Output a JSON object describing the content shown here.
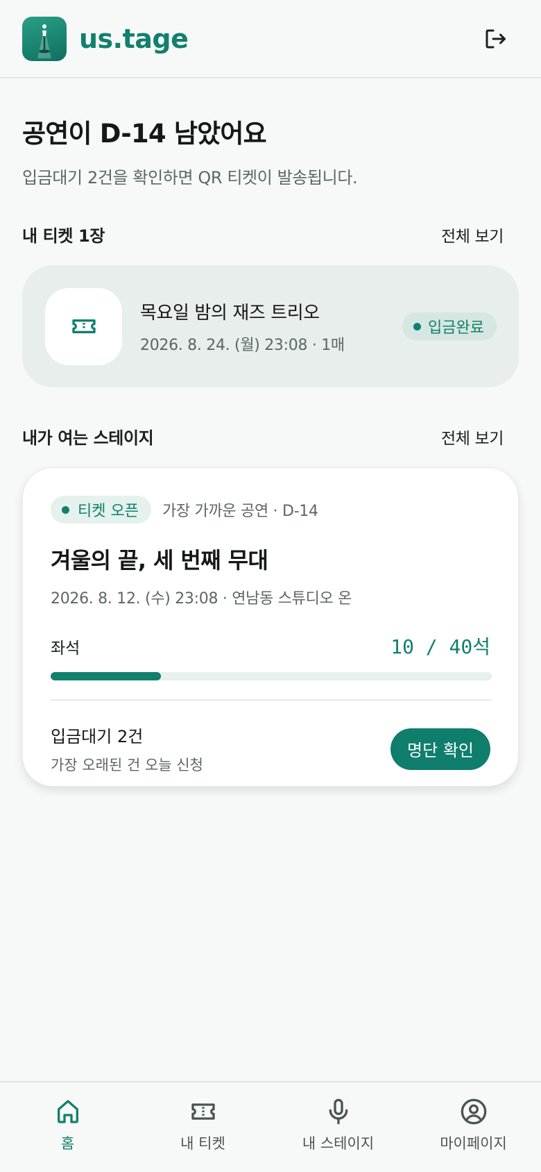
{
  "header": {
    "brand_name": "us.tage",
    "logo_icon": "microphone-stage-logo",
    "logout_icon": "logout-icon"
  },
  "hero": {
    "title": "공연이 D-14 남았어요",
    "subtitle": "입금대기 2건을 확인하면 QR 티켓이 발송됩니다."
  },
  "my_tickets": {
    "title": "내 티켓 1장",
    "see_all": "전체 보기",
    "items": [
      {
        "icon": "ticket-icon",
        "title": "목요일 밤의 재즈 트리오",
        "meta": "2026. 8. 24. (월) 23:08 · 1매",
        "status": "입금완료"
      }
    ]
  },
  "my_stages": {
    "title": "내가 여는 스테이지",
    "see_all": "전체 보기",
    "stage": {
      "badge": "티켓 오픈",
      "near_label": "가장 가까운 공연 · D-14",
      "title": "겨울의 끝, 세 번째 무대",
      "meta": "2026. 8. 12. (수) 23:08 · 연남동 스튜디오 온",
      "seat_label": "좌석",
      "seat_count": "10 / 40석",
      "seats_sold": 10,
      "seats_total": 40,
      "pending_title": "입금대기 2건",
      "pending_sub": "가장 오래된 건 오늘 신청",
      "action_label": "명단 확인"
    }
  },
  "bottom_nav": {
    "items": [
      {
        "label": "홈",
        "icon": "home-icon",
        "active": true
      },
      {
        "label": "내 티켓",
        "icon": "ticket-icon",
        "active": false
      },
      {
        "label": "내 스테이지",
        "icon": "microphone-icon",
        "active": false
      },
      {
        "label": "마이페이지",
        "icon": "user-circle-icon",
        "active": false
      }
    ]
  },
  "colors": {
    "accent": "#11806d",
    "background": "#f7f9f8",
    "ticket_card": "#e7eeeb"
  }
}
